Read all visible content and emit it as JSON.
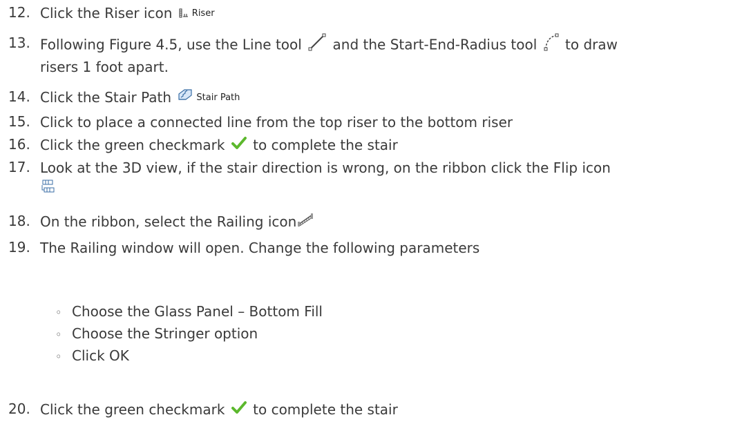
{
  "steps": [
    {
      "num": "12.",
      "text_before": "Click the Riser icon",
      "icon": "riser-icon",
      "icon_label": "Riser"
    },
    {
      "num": "13.",
      "text_a": "Following Figure 4.5, use the Line tool",
      "text_b": "and the Start-End-Radius tool",
      "text_c": "to draw",
      "text_d": "risers 1 foot apart.",
      "icon_a": "line-tool-icon",
      "icon_b": "start-end-radius-icon"
    },
    {
      "num": "14.",
      "text_before": "Click the Stair Path",
      "icon": "stair-path-icon",
      "icon_label": "Stair Path"
    },
    {
      "num": "15.",
      "text": "Click to place a connected line from the top riser to the bottom riser"
    },
    {
      "num": "16.",
      "text_before": "Click the green checkmark",
      "text_after": "to complete the stair",
      "icon": "green-checkmark-icon"
    },
    {
      "num": "17.",
      "text_before": "Look at the 3D view, if the stair direction is wrong, on the ribbon click the Flip icon",
      "icon": "flip-icon"
    },
    {
      "num": "18.",
      "text_before": "On the ribbon, select the Railing icon",
      "icon": "railing-icon"
    },
    {
      "num": "19.",
      "text": "The Railing window will open. Change the following parameters",
      "bullets": [
        "Choose the Glass Panel – Bottom Fill",
        "Choose the Stringer option",
        "Click OK"
      ],
      "bullet_glyph": "◦"
    },
    {
      "num": "20.",
      "text_before": "Click the green checkmark",
      "text_after": "to complete the stair",
      "icon": "green-checkmark-icon"
    }
  ],
  "colors": {
    "text": "#3a3a3a",
    "check": "#5cb82d",
    "icon_line": "#333333"
  }
}
